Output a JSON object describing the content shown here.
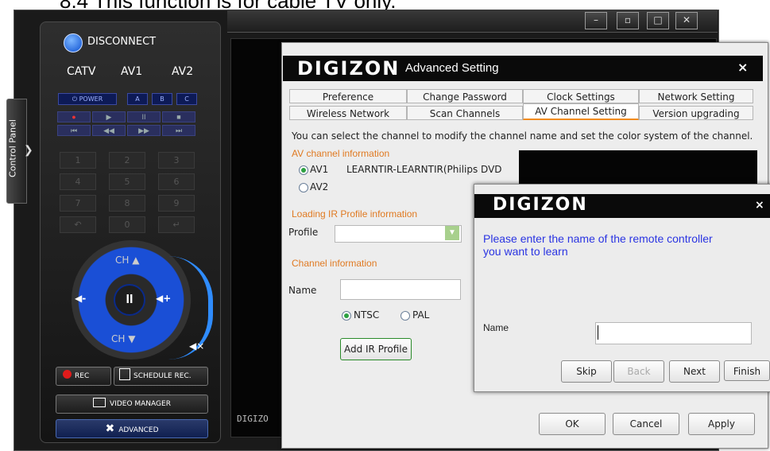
{
  "caption": "8.4    This function is for cable TV only.",
  "window": {
    "controls": [
      "–",
      "▫",
      "□",
      "✕"
    ],
    "bottom_brand": "DIGIZO"
  },
  "control_panel": {
    "tab_label": "Control Panel",
    "arrow": "❯",
    "disconnect": "DISCONNECT",
    "sources": [
      "CATV",
      "AV1",
      "AV2"
    ],
    "power": "⏻ POWER",
    "abc": [
      "A",
      "B",
      "C"
    ],
    "media_row1": [
      "●",
      "▶",
      "II",
      "■"
    ],
    "media_row2": [
      "⏮",
      "◀◀",
      "▶▶",
      "⏭"
    ],
    "keys": [
      "1",
      "2",
      "3",
      "4",
      "5",
      "6",
      "7",
      "8",
      "9",
      "↶",
      "0",
      "↵"
    ],
    "ch_up": "CH ▲",
    "ch_down": "CH ▼",
    "vol_down": "◀-",
    "vol_up": "◀+",
    "pause": "II",
    "mute": "◀×",
    "rec": "REC",
    "schedule_rec": "SCHEDULE REC.",
    "video_manager": "VIDEO MANAGER",
    "advanced": "ADVANCED"
  },
  "advanced_dialog": {
    "logo": "DIGIZON",
    "title": "Advanced Setting",
    "close": "×",
    "tabs_row1": [
      "Preference",
      "Change Password",
      "Clock Settings",
      "Network Setting"
    ],
    "tabs_row2": [
      "Wireless Network",
      "Scan Channels",
      "AV Channel Setting",
      "Version upgrading"
    ],
    "description": "You can select the channel to modify the channel name and set the color system of the channel.",
    "av_section": "AV channel information",
    "av1_label": "AV1",
    "av1_value": "LEARNTIR-LEARNTIR(Philips DVD",
    "av2_label": "AV2",
    "ir_section": "Loading IR Profile information",
    "profile_label": "Profile",
    "profile_value": "",
    "channel_section": "Channel information",
    "name_label": "Name",
    "name_value": "",
    "ntsc": "NTSC",
    "pal": "PAL",
    "add_ir": "Add IR Profile",
    "ok": "OK",
    "cancel": "Cancel",
    "apply": "Apply"
  },
  "learn_dialog": {
    "logo": "DIGIZON",
    "close": "×",
    "message": "Please enter the name of the remote controller you want to learn",
    "name_label": "Name",
    "name_value": "",
    "skip": "Skip",
    "back": "Back",
    "next": "Next",
    "finish": "Finish"
  },
  "colors": {
    "accent_orange": "#e07a22",
    "learn_text_blue": "#2a34e2",
    "remote_blue": "#1a4fd6"
  }
}
